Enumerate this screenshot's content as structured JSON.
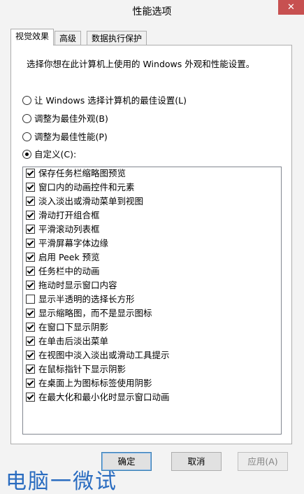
{
  "window": {
    "title": "性能选项",
    "close_glyph": "✕"
  },
  "tabs": [
    {
      "label": "视觉效果"
    },
    {
      "label": "高级"
    },
    {
      "label": "数据执行保护"
    }
  ],
  "description": "选择你想在此计算机上使用的 Windows 外观和性能设置。",
  "radios": [
    {
      "label": "让 Windows 选择计算机的最佳设置(L)",
      "checked": false
    },
    {
      "label": "调整为最佳外观(B)",
      "checked": false
    },
    {
      "label": "调整为最佳性能(P)",
      "checked": false
    },
    {
      "label": "自定义(C):",
      "checked": true
    }
  ],
  "options": [
    {
      "label": "保存任务栏缩略图预览",
      "checked": true
    },
    {
      "label": "窗口内的动画控件和元素",
      "checked": true
    },
    {
      "label": "淡入淡出或滑动菜单到视图",
      "checked": true
    },
    {
      "label": "滑动打开组合框",
      "checked": true
    },
    {
      "label": "平滑滚动列表框",
      "checked": true
    },
    {
      "label": "平滑屏幕字体边缘",
      "checked": true
    },
    {
      "label": "启用 Peek 预览",
      "checked": true
    },
    {
      "label": "任务栏中的动画",
      "checked": true
    },
    {
      "label": "拖动时显示窗口内容",
      "checked": true
    },
    {
      "label": "显示半透明的选择长方形",
      "checked": false
    },
    {
      "label": "显示缩略图，而不是显示图标",
      "checked": true
    },
    {
      "label": "在窗口下显示阴影",
      "checked": true
    },
    {
      "label": "在单击后淡出菜单",
      "checked": true
    },
    {
      "label": "在视图中淡入淡出或滑动工具提示",
      "checked": true
    },
    {
      "label": "在鼠标指针下显示阴影",
      "checked": true
    },
    {
      "label": "在桌面上为图标标签使用阴影",
      "checked": true
    },
    {
      "label": "在最大化和最小化时显示窗口动画",
      "checked": true
    }
  ],
  "buttons": {
    "ok": "确定",
    "cancel": "取消",
    "apply": "应用(A)"
  },
  "watermark": "电脑一微试"
}
